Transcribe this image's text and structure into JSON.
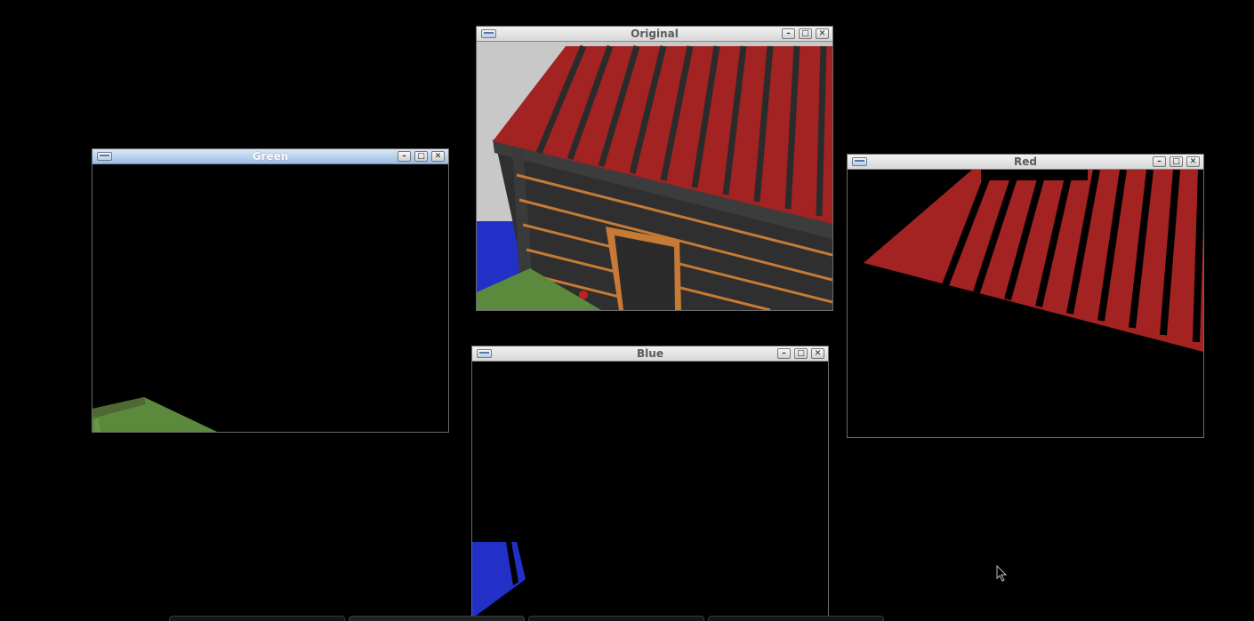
{
  "windows": {
    "original": {
      "title": "Original"
    },
    "green": {
      "title": "Green"
    },
    "red": {
      "title": "Red"
    },
    "blue": {
      "title": "Blue"
    }
  },
  "titlebar_buttons": {
    "minimize_icon": "minimize-icon",
    "maximize_icon": "maximize-icon",
    "close_icon": "close-icon"
  },
  "colors": {
    "roof_red": "#a32222",
    "grass_green": "#5c8a3c",
    "water_blue": "#2230c8",
    "wall_dark": "#2e2e2e",
    "wood_orange": "#c77a35",
    "titlebar_active": "#9cbde3"
  }
}
